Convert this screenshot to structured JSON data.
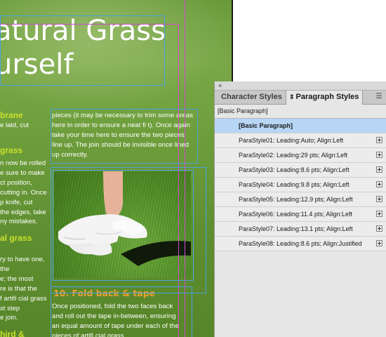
{
  "document": {
    "hero": {
      "line1": "atural Grass",
      "line2": "urself"
    },
    "left_column": {
      "frag_membrane": "brane",
      "frag_laid": "e laid, cut",
      "frag_grass": "grass",
      "lines_a": [
        "n now be rolled",
        "e sure to make",
        "ct position,",
        "cutting in. Once",
        "p knife, cut",
        "the edges, take",
        "ny mistakes."
      ],
      "frag_al_grass": "al grass",
      "lines_b": [
        "ry to have one,",
        "the",
        "e; the most",
        "re is that the",
        "f artifi cial grass",
        "xt step",
        "e join."
      ],
      "frag_third": "hird &"
    },
    "middle_column": {
      "lines": [
        "pieces (it may be necessary to trim some areas",
        "here in order to ensure a neat fi t). Once again",
        "take your time here to ensure the two pieces",
        "line up. The join should be invisible once lined",
        "up correctly."
      ],
      "step_heading": "10. Fold back & tape",
      "step_lines": [
        "Once positioned, fold the two faces back",
        "and roll out the tape in-between, ensuring",
        "an equal amount of tape under each of the",
        "pieces of artifi cial grass."
      ]
    }
  },
  "panel": {
    "close_glyph": "×",
    "tabs": [
      {
        "label": "Character Styles",
        "active": false
      },
      {
        "label": "Paragraph Styles",
        "active": true
      }
    ],
    "current_style": "[Basic Paragraph]",
    "styles": [
      {
        "label": "[Basic Paragraph]",
        "selected": true
      },
      {
        "label": "ParaStyle01: Leading:Auto; Align:Left",
        "selected": false
      },
      {
        "label": "ParaStyle02: Leading:29 pts; Align:Left",
        "selected": false
      },
      {
        "label": "ParaStyle03: Leading:8.6 pts; Align:Left",
        "selected": false
      },
      {
        "label": "ParaStyle04: Leading:9.8 pts; Align:Left",
        "selected": false
      },
      {
        "label": "ParaStyle05: Leading:12.9 pts; Align:Left",
        "selected": false
      },
      {
        "label": "ParaStyle06: Leading:11.4 pts; Align:Left",
        "selected": false
      },
      {
        "label": "ParaStyle07: Leading:13.1 pts; Align:Left",
        "selected": false
      },
      {
        "label": "ParaStyle08: Leading:8.6 pts; Align:Justified",
        "selected": false
      }
    ],
    "icons": {
      "style_override": "plus-overlay-icon",
      "tab_arrow": "double-arrow-icon",
      "menu": "panel-menu-icon"
    },
    "colors": {
      "selected_row": "#b7d5f5",
      "panel_bg": "#e6e6e6"
    }
  }
}
